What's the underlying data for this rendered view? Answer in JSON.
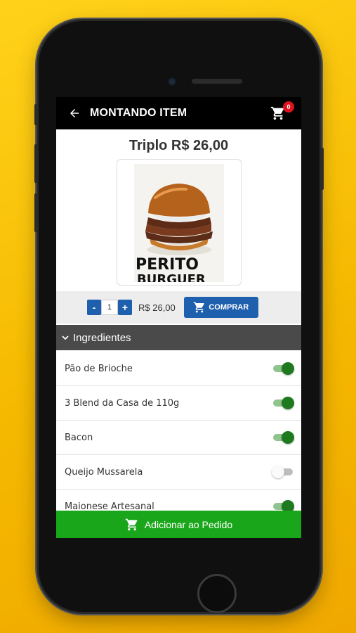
{
  "appbar": {
    "title": "MONTANDO ITEM",
    "cart_count": "0",
    "back_icon": "arrow-back-icon",
    "cart_icon": "shopping-cart-icon"
  },
  "product": {
    "title": "Triplo R$ 26,00",
    "image_text_line1": "PERITO",
    "image_text_line2": "BURGUER"
  },
  "purchase": {
    "minus_label": "-",
    "quantity": "1",
    "plus_label": "+",
    "price": "R$ 26,00",
    "buy_label": "COMPRAR"
  },
  "ingredients": {
    "header": "Ingredientes",
    "items": [
      {
        "name": "Pão de Brioche",
        "enabled": true
      },
      {
        "name": "3 Blend da Casa de 110g",
        "enabled": true
      },
      {
        "name": "Bacon",
        "enabled": true
      },
      {
        "name": "Queijo Mussarela",
        "enabled": false
      },
      {
        "name": "Maionese Artesanal",
        "enabled": true
      }
    ]
  },
  "footer": {
    "add_label": "Adicionar ao Pedido"
  },
  "colors": {
    "background": "#f5b900",
    "appbar": "#000000",
    "primary_button": "#1e5fae",
    "add_button": "#1aa61a",
    "toggle_on": "#1f7a1f",
    "badge": "#e0121b"
  }
}
